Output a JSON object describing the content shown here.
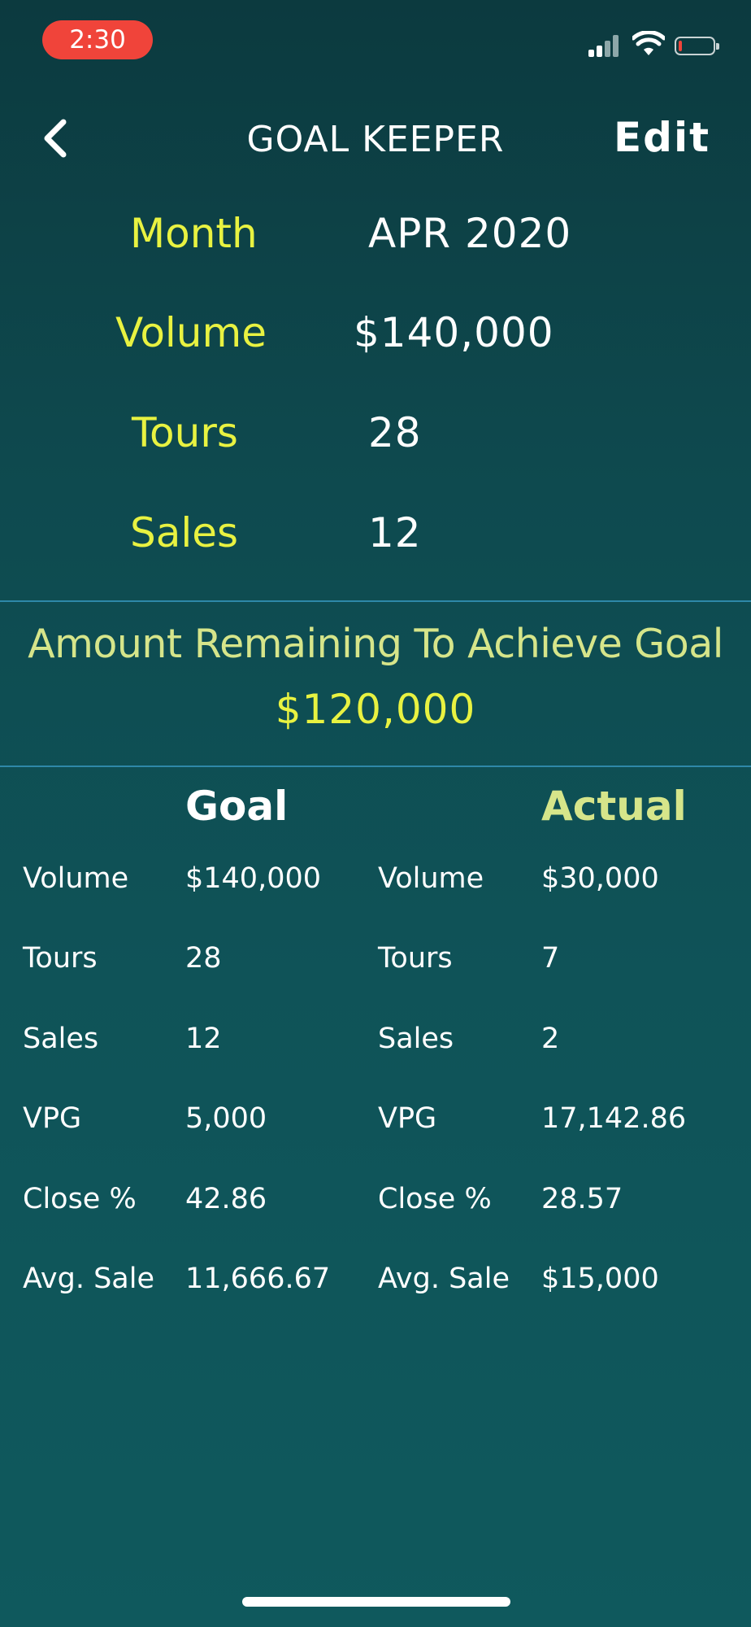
{
  "status_bar": {
    "time": "2:30",
    "signal_icon": "cellular-signal-icon",
    "wifi_icon": "wifi-icon",
    "battery_icon": "battery-low-icon",
    "battery_level": 0.08,
    "time_pill_color": "#f0443a"
  },
  "nav": {
    "back_icon": "chevron-left-icon",
    "title": "GOAL KEEPER",
    "edit_label": "Edit"
  },
  "goal": {
    "month_label": "Month",
    "month_value": "APR 2020",
    "volume_label": "Volume",
    "volume_value": "$140,000",
    "tours_label": "Tours",
    "tours_value": "28",
    "sales_label": "Sales",
    "sales_value": "12"
  },
  "remaining": {
    "title": "Amount Remaining To Achieve Goal",
    "amount": "$120,000"
  },
  "comparison": {
    "goal_header": "Goal",
    "actual_header": "Actual",
    "goal_rows": [
      {
        "label": "Volume",
        "value": "$140,000"
      },
      {
        "label": "Tours",
        "value": "28"
      },
      {
        "label": "Sales",
        "value": "12"
      },
      {
        "label": "VPG",
        "value": "5,000"
      },
      {
        "label": "Close %",
        "value": "42.86"
      },
      {
        "label": "Avg. Sale",
        "value": "11,666.67"
      }
    ],
    "actual_rows": [
      {
        "label": "Volume",
        "value": "$30,000"
      },
      {
        "label": "Tours",
        "value": "7"
      },
      {
        "label": "Sales",
        "value": "2"
      },
      {
        "label": "VPG",
        "value": "17,142.86"
      },
      {
        "label": "Close %",
        "value": "28.57"
      },
      {
        "label": "Avg. Sale",
        "value": "$15,000"
      }
    ]
  },
  "colors": {
    "accent_yellow": "#e8f241",
    "accent_light_green": "#d6e58a",
    "divider": "#2e88a8",
    "background_top": "#0c3a3f",
    "background_bottom": "#0f595d"
  }
}
